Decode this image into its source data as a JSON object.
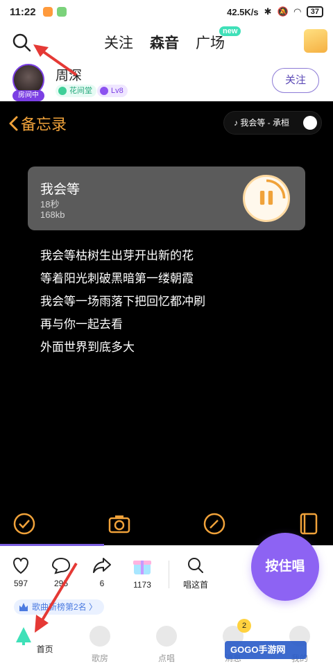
{
  "status_bar": {
    "time": "11:22",
    "network_speed": "42.5K/s",
    "battery": "37"
  },
  "top_nav": {
    "tabs": [
      {
        "label": "关注"
      },
      {
        "label": "森音"
      },
      {
        "label": "广场"
      }
    ],
    "active_tab": "森音",
    "new_badge": "new"
  },
  "profile": {
    "username": "周深",
    "room_badge": "房间中",
    "tag_group": "花间堂",
    "tag_level": "Lv8",
    "follow_label": "关注"
  },
  "memo": {
    "back_label": "备忘录",
    "now_playing": "我会等 - 承桓",
    "audio": {
      "title": "我会等",
      "duration": "18秒",
      "size": "168kb"
    },
    "lyrics": [
      "我会等枯树生出芽开出新的花",
      "等着阳光刺破黑暗第一缕朝霞",
      "我会等一场雨落下把回忆都冲刷",
      "再与你一起去看",
      "外面世界到底多大"
    ]
  },
  "actions": {
    "like_count": "597",
    "comment_count": "295",
    "share_count": "6",
    "gift_count": "1173",
    "sing_this_label": "唱这首",
    "hold_to_sing_label": "按住唱"
  },
  "rank_badge": "歌曲新榜第2名 〉",
  "bottom_nav": {
    "items": [
      {
        "label": "首页"
      },
      {
        "label": "歌房"
      },
      {
        "label": "点唱"
      },
      {
        "label": "消息"
      },
      {
        "label": "我的"
      }
    ],
    "message_badge": "2"
  },
  "watermark": "GOGO手游网",
  "colors": {
    "accent_purple": "#8d63f3",
    "accent_orange": "#f0a23a",
    "accent_green": "#3fe0b8",
    "arrow_red": "#e53935"
  }
}
